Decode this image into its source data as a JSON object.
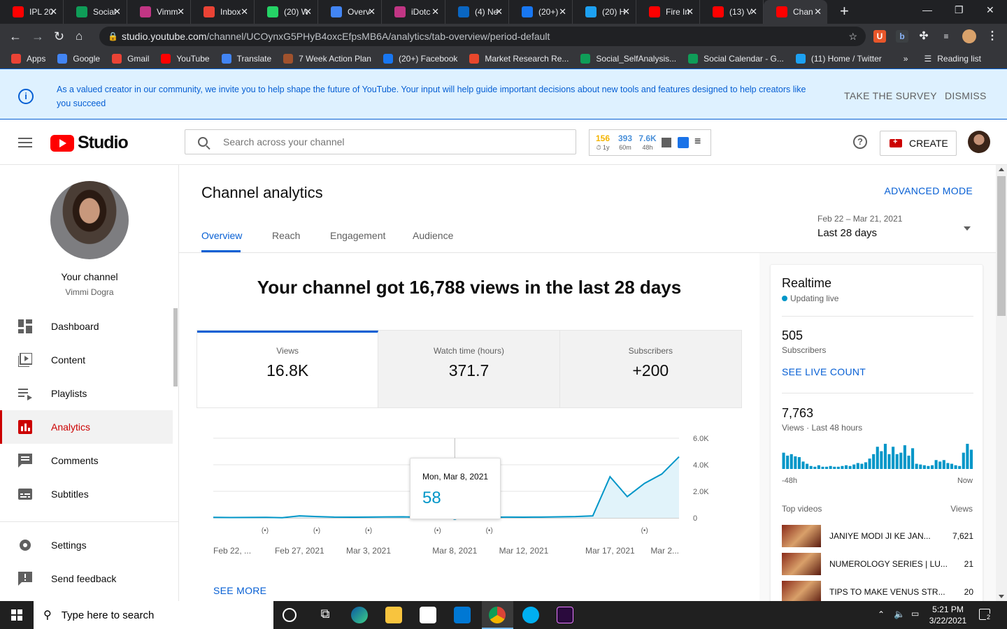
{
  "browser": {
    "tabs": [
      {
        "title": "IPL 20",
        "icon": "youtube-icon",
        "color": "#ff0000"
      },
      {
        "title": "Social",
        "icon": "sheets-icon",
        "color": "#0f9d58"
      },
      {
        "title": "Vimm",
        "icon": "instagram-icon",
        "color": "#c13584"
      },
      {
        "title": "Inbox",
        "icon": "gmail-icon",
        "color": "#ea4335"
      },
      {
        "title": "(20) W",
        "icon": "whatsapp-icon",
        "color": "#25d366"
      },
      {
        "title": "Overv",
        "icon": "google-ads-icon",
        "color": "#4285f4"
      },
      {
        "title": "iDotc",
        "icon": "instagram-icon",
        "color": "#c13584"
      },
      {
        "title": "(4) Ne",
        "icon": "linkedin-icon",
        "color": "#0a66c2"
      },
      {
        "title": "(20+)",
        "icon": "facebook-icon",
        "color": "#1877f2"
      },
      {
        "title": "(20) H",
        "icon": "twitter-icon",
        "color": "#1da1f2"
      },
      {
        "title": "Fire In",
        "icon": "youtube-icon",
        "color": "#ff0000"
      },
      {
        "title": "(13) V",
        "icon": "youtube-icon",
        "color": "#ff0000"
      },
      {
        "title": "Chan",
        "icon": "youtube-icon",
        "color": "#ff0000",
        "active": true
      }
    ],
    "url_host": "studio.youtube.com",
    "url_path": "/channel/UCOynxG5PHyB4oxcEfpsMB6A/analytics/tab-overview/period-default",
    "bookmarks": [
      {
        "label": "Apps",
        "color": "#ea4335"
      },
      {
        "label": "Google",
        "color": "#4285f4"
      },
      {
        "label": "Gmail",
        "color": "#ea4335"
      },
      {
        "label": "YouTube",
        "color": "#ff0000"
      },
      {
        "label": "Translate",
        "color": "#4285f4"
      },
      {
        "label": "7 Week Action Plan",
        "color": "#a0522d"
      },
      {
        "label": "(20+) Facebook",
        "color": "#1877f2"
      },
      {
        "label": "Market Research Re...",
        "color": "#e8472c"
      },
      {
        "label": "Social_SelfAnalysis...",
        "color": "#0f9d58"
      },
      {
        "label": "Social Calendar - G...",
        "color": "#0f9d58"
      },
      {
        "label": "(11) Home / Twitter",
        "color": "#1da1f2"
      }
    ],
    "reading_list": "Reading list"
  },
  "banner": {
    "message": "As a valued creator in our community, we invite you to help shape the future of YouTube. Your input will help guide important decisions about new tools and features designed to help creators like you succeed",
    "survey_label": "TAKE THE SURVEY",
    "dismiss_label": "DISMISS"
  },
  "header": {
    "logo_text": "Studio",
    "search_placeholder": "Search across your channel",
    "stats": [
      {
        "value": "156",
        "label": "1y",
        "color": "#f4b400"
      },
      {
        "value": "393",
        "label": "60m",
        "color": "#4a90d9"
      },
      {
        "value": "7.6K",
        "label": "48h",
        "color": "#4a90d9"
      }
    ],
    "create_label": "CREATE"
  },
  "sidebar": {
    "your_channel": "Your channel",
    "channel_name": "Vimmi Dogra",
    "items": [
      {
        "label": "Dashboard",
        "icon": "dashboard-icon"
      },
      {
        "label": "Content",
        "icon": "content-icon"
      },
      {
        "label": "Playlists",
        "icon": "playlists-icon"
      },
      {
        "label": "Analytics",
        "icon": "analytics-icon",
        "active": true
      },
      {
        "label": "Comments",
        "icon": "comments-icon"
      },
      {
        "label": "Subtitles",
        "icon": "subtitles-icon"
      }
    ],
    "bottom": [
      {
        "label": "Settings",
        "icon": "settings-icon"
      },
      {
        "label": "Send feedback",
        "icon": "feedback-icon"
      }
    ]
  },
  "main": {
    "title": "Channel analytics",
    "advanced_mode": "ADVANCED MODE",
    "tabs": [
      "Overview",
      "Reach",
      "Engagement",
      "Audience"
    ],
    "period_range": "Feb 22 – Mar 21, 2021",
    "period_label": "Last 28 days",
    "headline": "Your channel got 16,788 views in the last 28 days",
    "cards": [
      {
        "label": "Views",
        "value": "16.8K"
      },
      {
        "label": "Watch time (hours)",
        "value": "371.7"
      },
      {
        "label": "Subscribers",
        "value": "+200"
      }
    ],
    "see_more": "SEE MORE",
    "tooltip": {
      "date": "Mon, Mar 8, 2021",
      "value": "58"
    }
  },
  "chart_data": {
    "type": "area",
    "x": [
      "Feb 22",
      "Feb 23",
      "Feb 24",
      "Feb 25",
      "Feb 26",
      "Feb 27",
      "Feb 28",
      "Mar 1",
      "Mar 2",
      "Mar 3",
      "Mar 4",
      "Mar 5",
      "Mar 6",
      "Mar 7",
      "Mar 8",
      "Mar 9",
      "Mar 10",
      "Mar 11",
      "Mar 12",
      "Mar 13",
      "Mar 14",
      "Mar 15",
      "Mar 16",
      "Mar 17",
      "Mar 18",
      "Mar 19",
      "Mar 20",
      "Mar 21"
    ],
    "series": [
      {
        "values": [
          40,
          25,
          35,
          40,
          15,
          150,
          100,
          60,
          50,
          60,
          70,
          80,
          55,
          160,
          58,
          70,
          45,
          60,
          55,
          60,
          80,
          100,
          150,
          3100,
          1600,
          2600,
          3300,
          4600
        ]
      }
    ],
    "x_tick_labels": [
      "Feb 22, ...",
      "Feb 27, 2021",
      "Mar 3, 2021",
      "Mar 8, 2021",
      "Mar 12, 2021",
      "Mar 17, 2021",
      "Mar 2..."
    ],
    "y_tick_labels": [
      "0",
      "2.0K",
      "4.0K",
      "6.0K"
    ],
    "ylim": [
      0,
      6000
    ],
    "publish_markers": [
      "Feb 25",
      "Feb 28",
      "Mar 3",
      "Mar 7",
      "Mar 10",
      "Mar 19"
    ],
    "highlight_index": 14,
    "line_color": "#0096c8",
    "fill_color": "#e1f3fa"
  },
  "realtime": {
    "title": "Realtime",
    "live": "Updating live",
    "subs_value": "505",
    "subs_label": "Subscribers",
    "see_live": "SEE LIVE COUNT",
    "views_value": "7,763",
    "views_label": "Views · Last 48 hours",
    "bars": [
      22,
      18,
      20,
      17,
      16,
      10,
      7,
      4,
      3,
      5,
      3,
      3,
      4,
      3,
      3,
      4,
      5,
      4,
      6,
      8,
      7,
      9,
      14,
      20,
      30,
      24,
      34,
      20,
      30,
      20,
      22,
      32,
      18,
      28,
      7,
      6,
      5,
      4,
      5,
      12,
      10,
      12,
      8,
      7,
      5,
      4,
      22,
      34,
      26
    ],
    "axis_left": "-48h",
    "axis_right": "Now",
    "top_videos_label": "Top videos",
    "views_col": "Views",
    "videos": [
      {
        "title": "JANIYE MODI JI KE JAN...",
        "views": "7,621"
      },
      {
        "title": "NUMEROLOGY SERIES | LU...",
        "views": "21"
      },
      {
        "title": "TIPS TO MAKE VENUS STR...",
        "views": "20"
      }
    ]
  },
  "taskbar": {
    "search_placeholder": "Type here to search",
    "time": "5:21 PM",
    "date": "3/22/2021",
    "notif_count": "2"
  }
}
